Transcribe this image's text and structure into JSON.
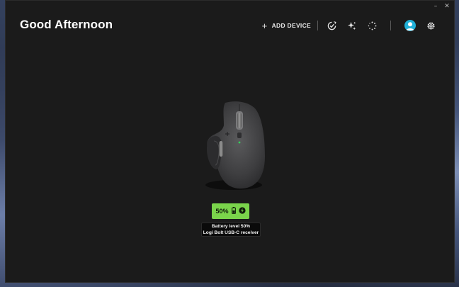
{
  "window": {
    "minimize_glyph": "–",
    "close_glyph": "✕"
  },
  "header": {
    "greeting": "Good Afternoon",
    "add_device_label": "ADD DEVICE",
    "icons": [
      "plus-icon",
      "update-check-icon",
      "sparkle-flow-icon",
      "loading-spinner-icon",
      "avatar-icon",
      "gear-icon"
    ]
  },
  "device": {
    "battery_percent_text": "50%",
    "battery_level": 0.5,
    "badge_color": "#7ad44b",
    "tooltip_line1": "Battery level 50%",
    "tooltip_line2": "Logi Bolt USB-C receiver"
  },
  "colors": {
    "app_background": "#1b1b1b",
    "avatar": "#21b0d8"
  }
}
